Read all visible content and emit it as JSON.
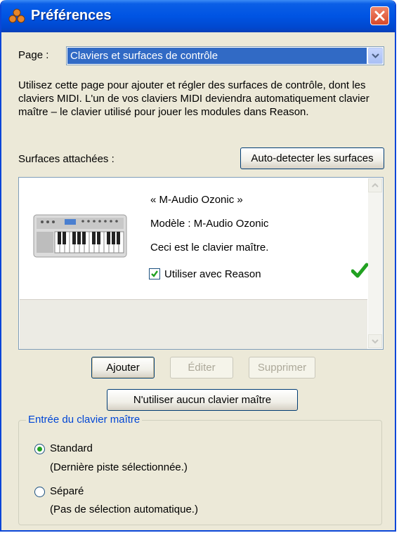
{
  "window": {
    "title": "Préférences"
  },
  "page": {
    "label": "Page :",
    "selected": "Claviers et surfaces de contrôle"
  },
  "description": "Utilisez cette page pour ajouter et régler des surfaces de contrôle, dont les claviers MIDI. L'un de vos claviers MIDI deviendra automatiquement clavier maître – le clavier utilisé pour jouer les modules dans Reason.",
  "surfaces": {
    "label": "Surfaces attachées :",
    "autodetect_button": "Auto-detecter les surfaces",
    "items": [
      {
        "name": "« M-Audio Ozonic »",
        "model": "Modèle : M-Audio Ozonic",
        "status": "Ceci est le clavier maître.",
        "use_with_reason_label": "Utiliser avec Reason",
        "use_with_reason_checked": true
      }
    ]
  },
  "buttons": {
    "add": "Ajouter",
    "edit": "Éditer",
    "delete": "Supprimer",
    "no_master": "N'utiliser aucun clavier maître"
  },
  "master_input": {
    "title": "Entrée du clavier maître",
    "options": [
      {
        "label": "Standard",
        "desc": "(Dernière piste sélectionnée.)",
        "selected": true
      },
      {
        "label": "Séparé",
        "desc": "(Pas de sélection automatique.)",
        "selected": false
      }
    ]
  },
  "colors": {
    "titlebar": "#0054e3",
    "selection": "#316ac5",
    "group_title": "#0046d5",
    "check_green": "#21a121",
    "close_button": "#e0563a"
  },
  "icons": {
    "app": "reason-app-icon",
    "close": "close-icon",
    "dropdown": "chevron-down-icon",
    "device": "midi-keyboard-icon",
    "master": "green-checkmark-icon"
  }
}
